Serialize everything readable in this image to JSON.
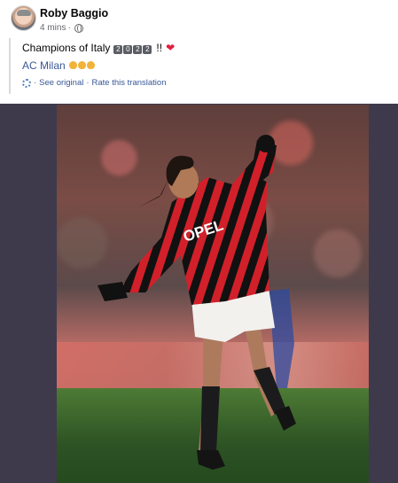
{
  "post": {
    "author": "Roby Baggio",
    "time": "4 mins",
    "separator": "·",
    "text": {
      "prefix": "Champions of Italy",
      "year_digits": [
        "2",
        "0",
        "2",
        "2"
      ],
      "exclaim": "!!",
      "club_link": "AC Milan"
    },
    "actions": {
      "see_original": "See original",
      "rate_translation": "Rate this translation"
    }
  },
  "colors": {
    "link": "#385898",
    "heart": "#e41e3f",
    "jersey_red": "#d2202a",
    "jersey_black": "#111111"
  },
  "photo": {
    "jersey_sponsor": "OPEL"
  }
}
